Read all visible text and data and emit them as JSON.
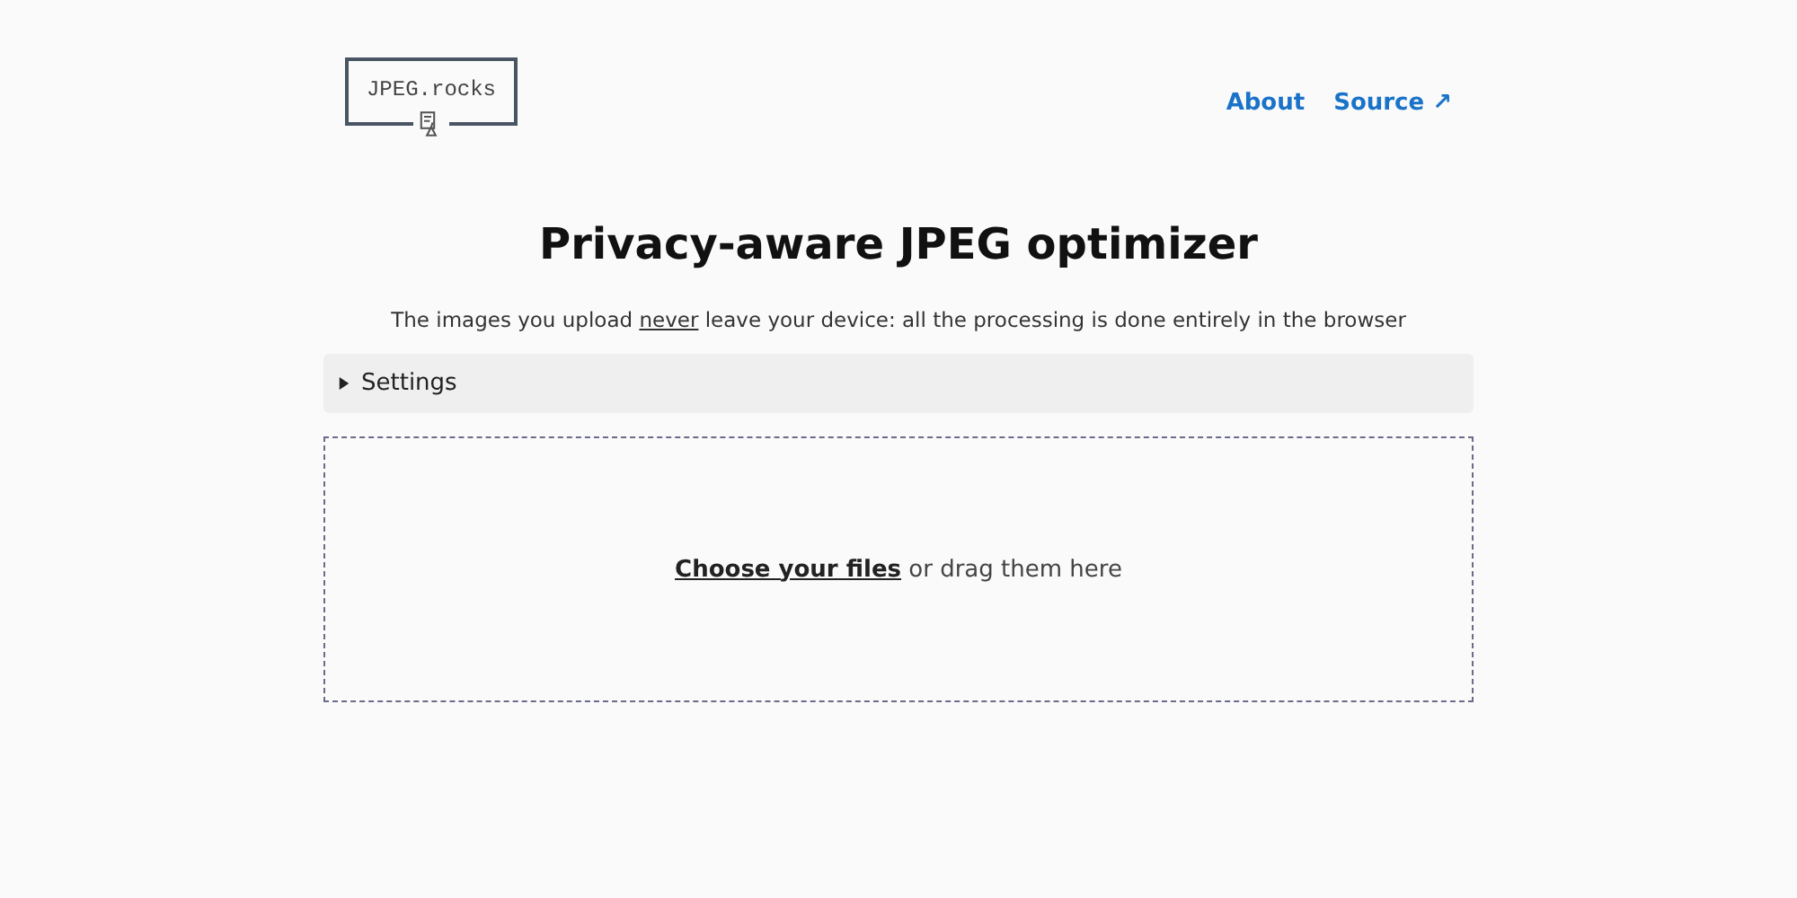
{
  "logo": {
    "text": "JPEG.rocks"
  },
  "nav": [
    {
      "label": "About"
    },
    {
      "label": "Source ↗"
    }
  ],
  "title": "Privacy-aware JPEG optimizer",
  "subtitle": [
    {
      "text": "The images you upload ",
      "underlined": false
    },
    {
      "text": "never",
      "underlined": true
    },
    {
      "text": " leave your device: all the processing is done entirely in the browser",
      "underlined": false
    }
  ],
  "settings": {
    "label": "Settings",
    "expanded": false
  },
  "dropzone": {
    "link": "Choose your files",
    "text": " or drag them here"
  }
}
